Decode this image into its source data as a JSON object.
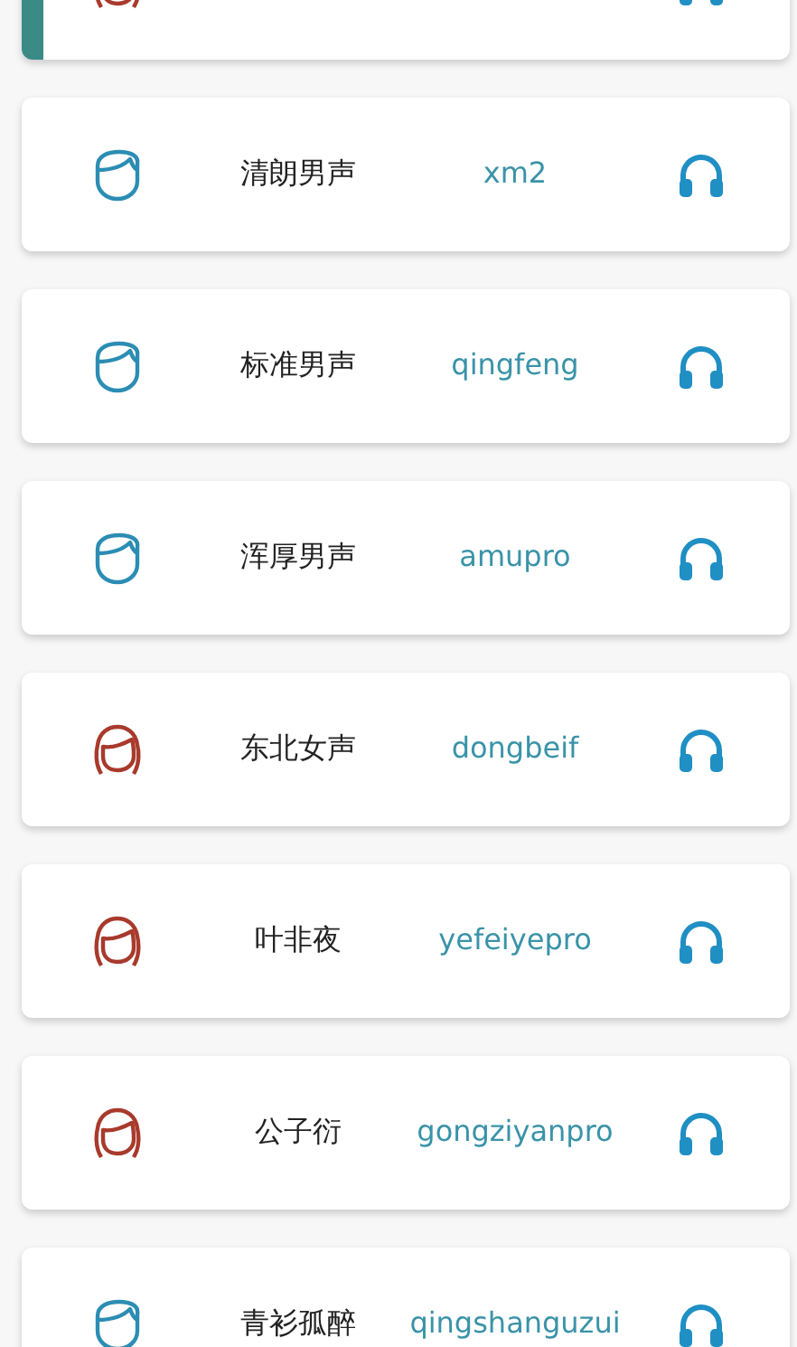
{
  "voices": [
    {
      "kind": "female",
      "selected": true
    },
    {
      "kind": "male",
      "name": "清朗男声",
      "code": "xm2",
      "selected": false
    },
    {
      "kind": "male",
      "name": "标准男声",
      "code": "qingfeng",
      "selected": false
    },
    {
      "kind": "male",
      "name": "浑厚男声",
      "code": "amupro",
      "selected": false
    },
    {
      "kind": "female",
      "name": "东北女声",
      "code": "dongbeif",
      "selected": false
    },
    {
      "kind": "female",
      "name": "叶非夜",
      "code": "yefeiyepro",
      "selected": false
    },
    {
      "kind": "female",
      "name": "公子衍",
      "code": "gongziyanpro",
      "selected": false
    },
    {
      "kind": "male",
      "name": "青衫孤醉",
      "code": "qingshanguzui",
      "selected": false
    }
  ]
}
